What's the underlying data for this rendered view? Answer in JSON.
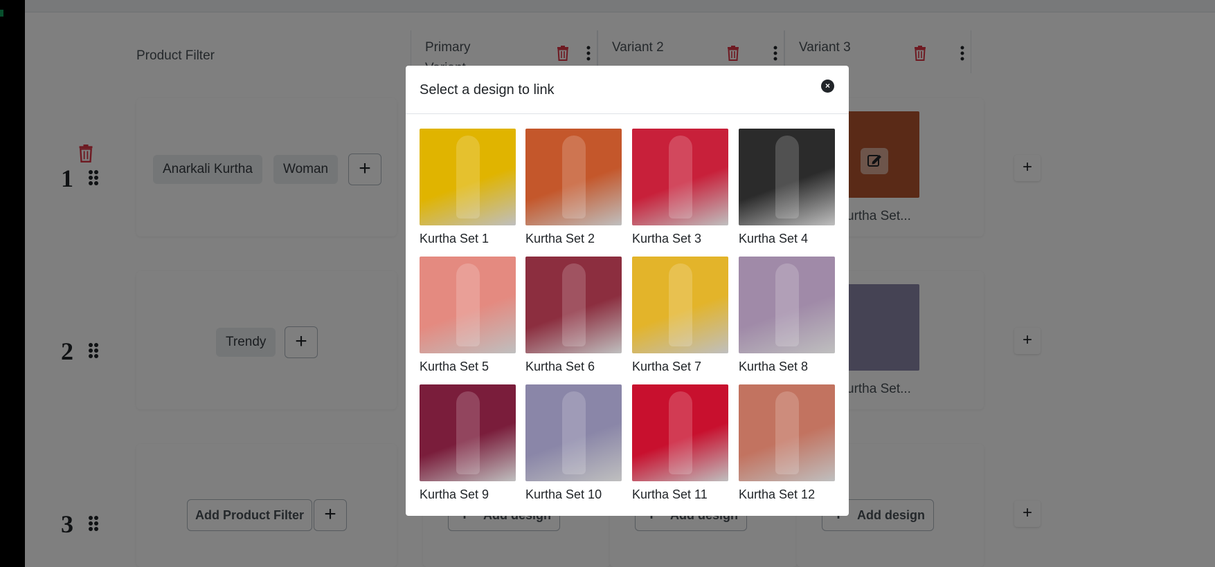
{
  "table": {
    "product_filter_header": "Product Filter",
    "columns": [
      {
        "label": "Primary Variant"
      },
      {
        "label": "Variant 2"
      },
      {
        "label": "Variant 3"
      }
    ],
    "rows": [
      {
        "number": "1",
        "chips": [
          "Anarkali Kurtha",
          "Woman"
        ],
        "captions": [
          "urtha Set..."
        ]
      },
      {
        "number": "2",
        "chips": [
          "Trendy"
        ],
        "captions": [
          "urtha Set..."
        ]
      },
      {
        "number": "3",
        "add_filter_label": "Add Product Filter",
        "add_design_label": "Add design"
      }
    ],
    "add_symbol": "+"
  },
  "modal": {
    "title": "Select a design to link",
    "close_symbol": "×",
    "designs": [
      {
        "name": "Kurtha Set 1",
        "color": "#e0b400"
      },
      {
        "name": "Kurtha Set 2",
        "color": "#c4572b"
      },
      {
        "name": "Kurtha Set 3",
        "color": "#c8203a"
      },
      {
        "name": "Kurtha Set 4",
        "color": "#2b2b2b"
      },
      {
        "name": "Kurtha Set 5",
        "color": "#e48a80"
      },
      {
        "name": "Kurtha Set 6",
        "color": "#8c2e3f"
      },
      {
        "name": "Kurtha Set 7",
        "color": "#e3b42a"
      },
      {
        "name": "Kurtha Set 8",
        "color": "#a08aa8"
      },
      {
        "name": "Kurtha Set 9",
        "color": "#7a1d3b"
      },
      {
        "name": "Kurtha Set 10",
        "color": "#8a86a8"
      },
      {
        "name": "Kurtha Set 11",
        "color": "#c8102e"
      },
      {
        "name": "Kurtha Set 12",
        "color": "#c27360"
      }
    ]
  },
  "colors": {
    "danger": "#dc3545",
    "backdrop": "rgba(0,0,0,0.5)"
  }
}
